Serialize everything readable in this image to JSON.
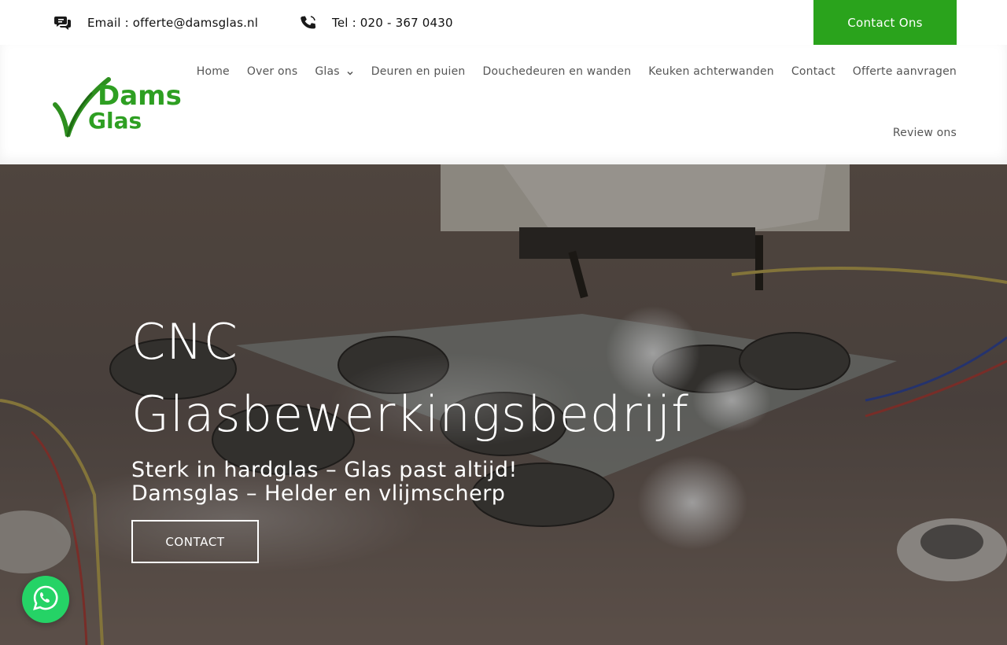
{
  "topbar": {
    "email_label": "Email : offerte@damsglas.nl",
    "phone_label": "Tel : 020 - 367 0430",
    "contact_button": "Contact Ons",
    "email_icon": "chat-bubbles-icon",
    "phone_icon": "phone-icon"
  },
  "logo": {
    "line1": "Dams",
    "line2": "Glas"
  },
  "nav": {
    "items": [
      "Home",
      "Over ons",
      "Glas",
      "Deuren en puien",
      "Douchedeuren en wanden",
      "Keuken achterwanden",
      "Contact",
      "Offerte aanvragen",
      "Review ons"
    ]
  },
  "hero": {
    "title_line1": "CNC",
    "title_line2": "Glasbewerkingsbedrijf",
    "subtitle_line1": "Sterk in hardglas – Glas past altijd!",
    "subtitle_line2": "Damsglas – Helder en vlijmscherp",
    "button": "CONTACT"
  },
  "colors": {
    "brand_green": "#2aa31c",
    "whatsapp_green": "#25d366"
  },
  "floating": {
    "whatsapp_icon": "whatsapp-icon"
  }
}
